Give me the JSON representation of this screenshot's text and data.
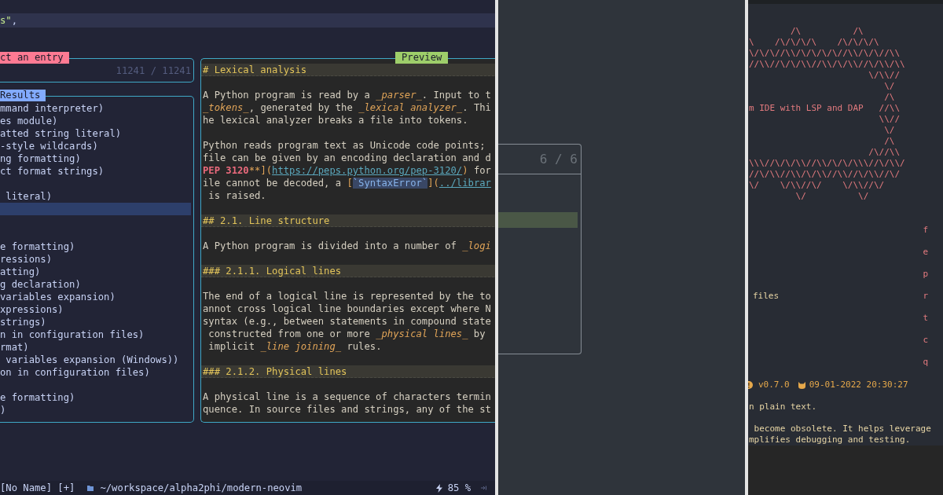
{
  "editor": {
    "cursor_line": [
      {
        "text": "s\"",
        "kind": "string"
      },
      {
        "text": ",",
        "kind": "plain"
      }
    ]
  },
  "telescope": {
    "prompt": {
      "title": "ct an entry",
      "count": "11241 / 11241"
    },
    "results": {
      "title": "Results",
      "items": [
        {
          "text": "mmand interpreter)",
          "selected": false
        },
        {
          "text": "es module)",
          "selected": false
        },
        {
          "text": "atted string literal)",
          "selected": false
        },
        {
          "text": "-style wildcards)",
          "selected": false
        },
        {
          "text": "ng formatting)",
          "selected": false
        },
        {
          "text": "ct format strings)",
          "selected": false
        },
        {
          "selected": false
        },
        {
          "text": " literal)",
          "selected": false
        },
        {
          "selected": true
        },
        {
          "selected": false
        },
        {
          "selected": false
        },
        {
          "text": "e formatting)",
          "selected": false
        },
        {
          "text": "ressions)",
          "selected": false
        },
        {
          "text": "atting)",
          "selected": false
        },
        {
          "text": "g declaration)",
          "selected": false
        },
        {
          "text": "variables expansion)",
          "selected": false
        },
        {
          "text": "xpressions)",
          "selected": false
        },
        {
          "text": "strings)",
          "selected": false
        },
        {
          "text": "n in configuration files)",
          "selected": false
        },
        {
          "text": "rmat)",
          "selected": false
        },
        {
          "text": " variables expansion (Windows))",
          "selected": false
        },
        {
          "text": "on in configuration files)",
          "selected": false
        },
        {
          "selected": false
        },
        {
          "text": "e formatting)",
          "selected": false
        },
        {
          "text": ")",
          "selected": false
        }
      ]
    },
    "preview": {
      "title": "Preview",
      "lines": [
        {
          "kind": "heading",
          "text": "# Lexical analysis"
        },
        {
          "kind": "blank"
        },
        {
          "kind": "text",
          "segments": [
            {
              "text": "A Python program is read by a ",
              "kind": "plain"
            },
            {
              "text": "_parser_",
              "kind": "emph"
            },
            {
              "text": ". Input to t",
              "kind": "plain"
            }
          ]
        },
        {
          "kind": "text",
          "segments": [
            {
              "text": "_tokens_",
              "kind": "emph"
            },
            {
              "text": ", generated by the ",
              "kind": "plain"
            },
            {
              "text": "_lexical analyzer_",
              "kind": "emph"
            },
            {
              "text": ". Thi",
              "kind": "plain"
            }
          ]
        },
        {
          "kind": "text",
          "segments": [
            {
              "text": "he lexical analyzer breaks a file into tokens.",
              "kind": "plain"
            }
          ]
        },
        {
          "kind": "blank"
        },
        {
          "kind": "text",
          "segments": [
            {
              "text": "Python reads program text as Unicode code points;",
              "kind": "plain"
            }
          ]
        },
        {
          "kind": "text",
          "segments": [
            {
              "text": "file can be given by an encoding declaration and d",
              "kind": "plain"
            }
          ]
        },
        {
          "kind": "text",
          "segments": [
            {
              "text": "PEP 3120",
              "kind": "strong"
            },
            {
              "text": "**](",
              "kind": "punct"
            },
            {
              "text": "https://peps.python.org/pep-3120/",
              "kind": "link"
            },
            {
              "text": ")",
              "kind": "punct"
            },
            {
              "text": " for",
              "kind": "plain"
            }
          ]
        },
        {
          "kind": "text",
          "segments": [
            {
              "text": "ile cannot be decoded, a ",
              "kind": "plain"
            },
            {
              "text": "[",
              "kind": "punct"
            },
            {
              "text": "`SyntaxError`",
              "kind": "code"
            },
            {
              "text": "](",
              "kind": "punct"
            },
            {
              "text": "../librar",
              "kind": "link"
            }
          ]
        },
        {
          "kind": "text",
          "segments": [
            {
              "text": " is raised.",
              "kind": "plain"
            }
          ]
        },
        {
          "kind": "blank"
        },
        {
          "kind": "heading",
          "text": "## 2.1. Line structure"
        },
        {
          "kind": "blank"
        },
        {
          "kind": "text",
          "segments": [
            {
              "text": "A Python program is divided into a number of ",
              "kind": "plain"
            },
            {
              "text": "_logi",
              "kind": "emph"
            }
          ]
        },
        {
          "kind": "blank"
        },
        {
          "kind": "heading",
          "text": "### 2.1.1. Logical lines"
        },
        {
          "kind": "blank"
        },
        {
          "kind": "text",
          "segments": [
            {
              "text": "The end of a logical line is represented by the to",
              "kind": "plain"
            }
          ]
        },
        {
          "kind": "text",
          "segments": [
            {
              "text": "annot cross logical line boundaries except where N",
              "kind": "plain"
            }
          ]
        },
        {
          "kind": "text",
          "segments": [
            {
              "text": "syntax (e.g., between statements in compound state",
              "kind": "plain"
            }
          ]
        },
        {
          "kind": "text",
          "segments": [
            {
              "text": " constructed from one or more ",
              "kind": "plain"
            },
            {
              "text": "_physical lines_",
              "kind": "emph"
            },
            {
              "text": " by",
              "kind": "plain"
            }
          ]
        },
        {
          "kind": "text",
          "segments": [
            {
              "text": " implicit ",
              "kind": "plain"
            },
            {
              "text": "_line joining_",
              "kind": "emph"
            },
            {
              "text": " rules.",
              "kind": "plain"
            }
          ]
        },
        {
          "kind": "blank"
        },
        {
          "kind": "heading",
          "text": "### 2.1.2. Physical lines"
        },
        {
          "kind": "blank"
        },
        {
          "kind": "text",
          "segments": [
            {
              "text": "A physical line is a sequence of characters termin",
              "kind": "plain"
            }
          ]
        },
        {
          "kind": "text",
          "segments": [
            {
              "text": "quence. In source files and strings, any of the st",
              "kind": "plain"
            }
          ]
        }
      ]
    }
  },
  "status_bar": {
    "buffer": "[No Name] [+]",
    "path": "~/workspace/alpha2phi/modern-neovim",
    "percent": "85 %"
  },
  "picker": {
    "count": "6 / 6",
    "rows": [
      {
        "selected": false
      },
      {
        "selected": false
      },
      {
        "selected": true
      }
    ]
  },
  "dashboard": {
    "header": [
      "        /\\          /\\",
      "\\    /\\/\\/\\/\\    /\\/\\/\\/\\",
      "\\/\\/\\//\\\\/\\/\\/\\/\\//\\\\/\\/\\//\\\\",
      "//\\\\//\\/\\/\\\\//\\\\/\\/\\\\//\\/\\\\/\\\\",
      "                       \\/\\\\//",
      "                          \\/",
      "                          /\\",
      "m IDE with LSP and DAP   //\\\\",
      "                         \\\\//",
      "                          \\/",
      "                          /\\",
      "                       /\\//\\\\",
      "\\\\\\//\\/\\/\\\\//\\\\/\\/\\/\\\\\\//\\/\\\\/",
      "//\\/\\\\//\\\\/\\/\\\\//\\\\//\\/\\\\//\\/",
      "\\/    \\/\\\\//\\/    \\/\\\\//\\/",
      "         \\/          \\/"
    ],
    "buttons": [
      {
        "key": "f"
      },
      {
        "key": "e"
      },
      {
        "key": "p"
      },
      {
        "label": "files",
        "key": "r"
      },
      {
        "key": "t"
      },
      {
        "key": "c"
      },
      {
        "key": "q"
      }
    ],
    "footer": {
      "version": "v0.7.0",
      "date": "09-01-2022 20:30:27"
    },
    "quote": [
      {
        "lines": [
          "n plain text."
        ]
      },
      {
        "lines": [
          " become obsolete. It helps leverage",
          "mplifies debugging and testing."
        ]
      }
    ]
  }
}
